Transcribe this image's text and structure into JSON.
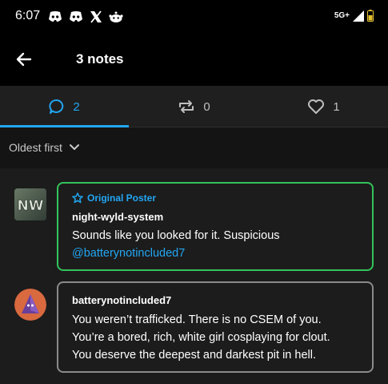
{
  "status_bar": {
    "time": "6:07",
    "network": "5G+",
    "icons": [
      "discord-icon",
      "discord-icon",
      "x-icon",
      "reddit-icon",
      "signal-icon",
      "battery-icon"
    ]
  },
  "header": {
    "title": "3 notes",
    "back_icon": "back-arrow-icon"
  },
  "tabs": [
    {
      "icon": "comment-icon",
      "count": "2",
      "active": true
    },
    {
      "icon": "reblog-icon",
      "count": "0",
      "active": false
    },
    {
      "icon": "heart-icon",
      "count": "1",
      "active": false
    }
  ],
  "sort": {
    "label": "Oldest first",
    "icon": "chevron-down-icon"
  },
  "notes": [
    {
      "avatar_text": "NW",
      "badge": "Original Poster",
      "username": "night-wyld-system",
      "text": "Sounds like you looked for it. Suspicious",
      "mention": "@batterynotincluded7"
    },
    {
      "username": "batterynotincluded7",
      "text_lines": [
        "You weren’t trafficked. There is no CSEM of you.",
        "You’re a bored, rich, white girl cosplaying for clout.",
        "You deserve the deepest and darkest pit in hell."
      ]
    }
  ],
  "colors": {
    "accent_blue": "#22a6f2",
    "op_border": "#33c35a",
    "reply_border": "#8a8a8a",
    "background": "#1c1c1c"
  }
}
